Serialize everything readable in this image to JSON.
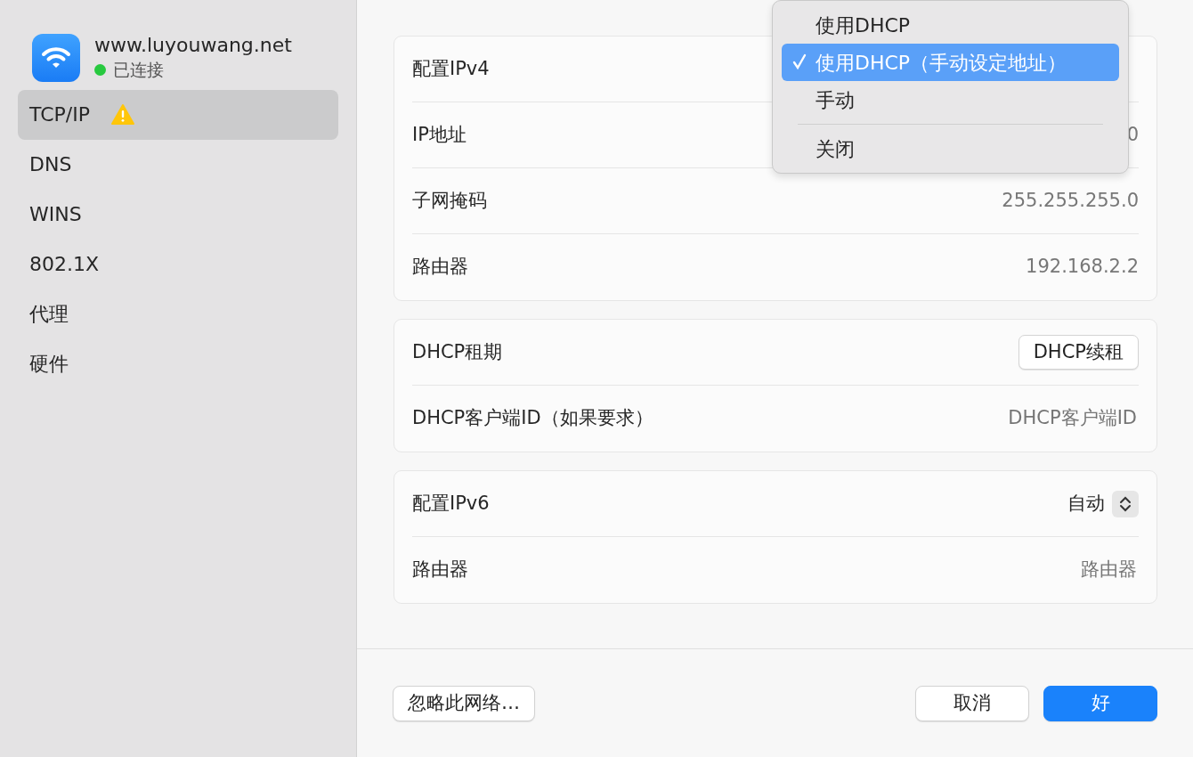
{
  "sidebar": {
    "network": {
      "name": "www.luyouwang.net",
      "status": "已连接",
      "connected": true
    },
    "items": [
      {
        "label": "TCP/IP",
        "selected": true,
        "warning": true
      },
      {
        "label": "DNS",
        "selected": false,
        "warning": false
      },
      {
        "label": "WINS",
        "selected": false,
        "warning": false
      },
      {
        "label": "802.1X",
        "selected": false,
        "warning": false
      },
      {
        "label": "代理",
        "selected": false,
        "warning": false
      },
      {
        "label": "硬件",
        "selected": false,
        "warning": false
      }
    ]
  },
  "sections": [
    {
      "rows": [
        {
          "kind": "popup",
          "label": "配置IPv4"
        },
        {
          "kind": "value",
          "label": "IP地址",
          "value": "0"
        },
        {
          "kind": "value",
          "label": "子网掩码",
          "value": "255.255.255.0"
        },
        {
          "kind": "value",
          "label": "路由器",
          "value": "192.168.2.2"
        }
      ]
    },
    {
      "rows": [
        {
          "kind": "button",
          "label": "DHCP租期",
          "button": "DHCP续租"
        },
        {
          "kind": "field",
          "label": "DHCP客户端ID（如果要求）",
          "placeholder": "DHCP客户端ID"
        }
      ]
    },
    {
      "rows": [
        {
          "kind": "popup",
          "label": "配置IPv6",
          "value": "自动"
        },
        {
          "kind": "field",
          "label": "路由器",
          "placeholder": "路由器"
        }
      ]
    }
  ],
  "menu": {
    "items": [
      {
        "kind": "item",
        "label": "使用DHCP",
        "selected": false
      },
      {
        "kind": "item",
        "label": "使用DHCP（手动设定地址）",
        "selected": true
      },
      {
        "kind": "item",
        "label": "手动",
        "selected": false
      },
      {
        "kind": "separator"
      },
      {
        "kind": "item",
        "label": "关闭",
        "selected": false
      }
    ]
  },
  "footer": {
    "left_button": "忽略此网络…",
    "cancel_button": "取消",
    "ok_button": "好"
  }
}
